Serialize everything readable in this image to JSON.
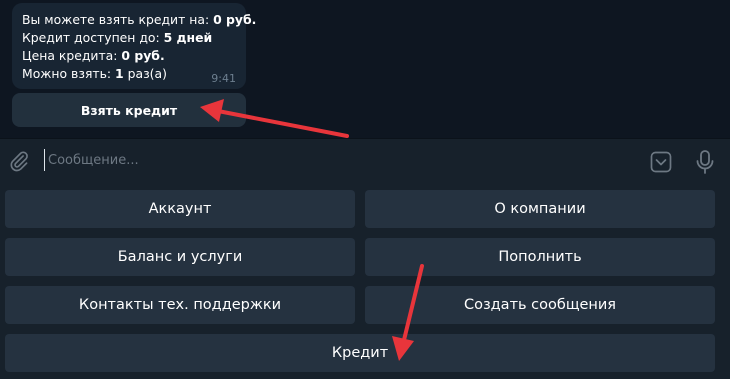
{
  "message": {
    "lines": [
      {
        "prefix": "Вы можете взять кредит на: ",
        "value": "0 руб."
      },
      {
        "prefix": "Кредит доступен до: ",
        "value": "5 дней"
      },
      {
        "prefix": "Цена кредита: ",
        "value": "0 руб."
      },
      {
        "prefix": "Можно взять: ",
        "value": "1",
        "suffix": " раз(а)"
      }
    ],
    "time": "9:41",
    "inline_button": "Взять кредит"
  },
  "input": {
    "placeholder": "Сообщение..."
  },
  "icons": {
    "attach": "paperclip-icon",
    "keyboard": "keyboard-toggle-icon",
    "mic": "microphone-icon"
  },
  "keyboard": {
    "account": "Аккаунт",
    "about": "О компании",
    "balance": "Баланс и услуги",
    "topup": "Пополнить",
    "support": "Контакты тех. поддержки",
    "create_messages": "Создать сообщения",
    "credit": "Кредит"
  },
  "colors": {
    "annotation_arrow": "#e8353b",
    "chat_background": "#0e1621",
    "panel_background": "#17212b",
    "button_background": "#253240"
  }
}
